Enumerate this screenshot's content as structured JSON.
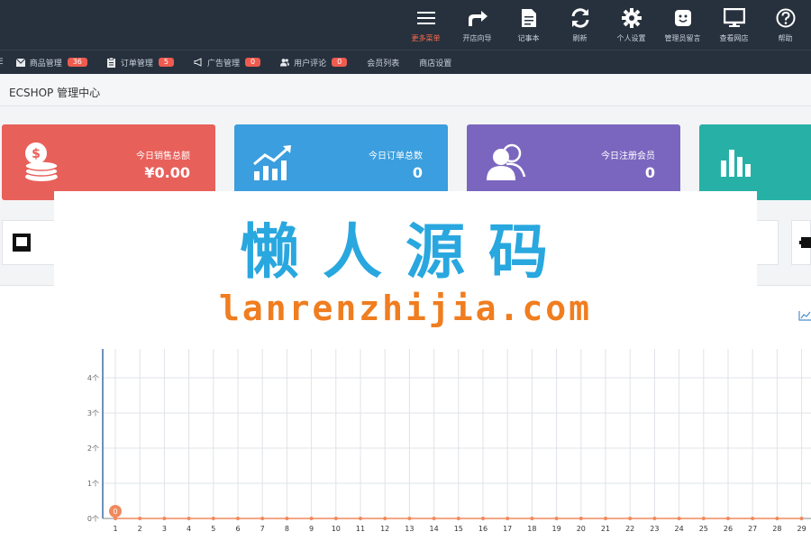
{
  "topbar": {
    "items": [
      {
        "label": "更多菜单",
        "icon": "menu-icon",
        "active": true
      },
      {
        "label": "开店向导",
        "icon": "share-arrow-icon",
        "active": false
      },
      {
        "label": "记事本",
        "icon": "notepad-icon",
        "active": false
      },
      {
        "label": "刷新",
        "icon": "refresh-icon",
        "active": false
      },
      {
        "label": "个人设置",
        "icon": "gear-icon",
        "active": false
      },
      {
        "label": "管理员留言",
        "icon": "message-icon",
        "active": false
      },
      {
        "label": "查看网店",
        "icon": "monitor-icon",
        "active": false
      },
      {
        "label": "帮助",
        "icon": "help-icon",
        "active": false
      }
    ]
  },
  "subnav": {
    "edge_label": "E",
    "items": [
      {
        "label": "商品管理",
        "badge": "36",
        "icon": "mail-icon"
      },
      {
        "label": "订单管理",
        "badge": "5",
        "icon": "clipboard-icon"
      },
      {
        "label": "广告管理",
        "badge": "0",
        "icon": "megaphone-icon"
      },
      {
        "label": "用户评论",
        "badge": "0",
        "icon": "users-icon"
      },
      {
        "label": "会员列表",
        "badge": null,
        "icon": null
      },
      {
        "label": "商店设置",
        "badge": null,
        "icon": null
      }
    ]
  },
  "page": {
    "title": "ECSHOP 管理中心"
  },
  "cards": [
    {
      "label": "今日销售总额",
      "value": "¥0.00",
      "color": "#e8605a",
      "icon": "coins-icon"
    },
    {
      "label": "今日订单总数",
      "value": "0",
      "color": "#3b9ede",
      "icon": "trend-chart-icon"
    },
    {
      "label": "今日注册会员",
      "value": "0",
      "color": "#7b66bf",
      "icon": "members-icon"
    },
    {
      "label": "",
      "value": "",
      "color": "#27b1a6",
      "icon": "bar-chart-icon"
    }
  ],
  "watermark": {
    "cn": "懒人源码",
    "en": "lanrenzhijia.com"
  },
  "chart_data": {
    "type": "line",
    "title": "",
    "xlabel": "",
    "ylabel": "",
    "x": [
      1,
      2,
      3,
      4,
      5,
      6,
      7,
      8,
      9,
      10,
      11,
      12,
      13,
      14,
      15,
      16,
      17,
      18,
      19,
      20,
      21,
      22,
      23,
      24,
      25,
      26,
      27,
      28,
      29
    ],
    "series": [
      {
        "values": [
          0,
          0,
          0,
          0,
          0,
          0,
          0,
          0,
          0,
          0,
          0,
          0,
          0,
          0,
          0,
          0,
          0,
          0,
          0,
          0,
          0,
          0,
          0,
          0,
          0,
          0,
          0,
          0,
          0
        ]
      }
    ],
    "yticks": [
      "0个",
      "1个",
      "2个",
      "3个",
      "4个"
    ],
    "ylim": [
      0,
      4
    ],
    "point_label": "0",
    "grid": true,
    "colors": {
      "line": "#f08a5d",
      "axis": "#3b6ea5",
      "grid": "#dfe3e8"
    }
  }
}
